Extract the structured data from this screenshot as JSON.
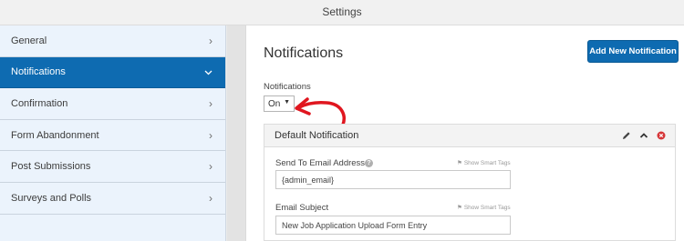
{
  "window": {
    "title": "Settings"
  },
  "sidebar": {
    "items": [
      {
        "label": "General",
        "chevron": "chevron-right-icon",
        "active": false
      },
      {
        "label": "Notifications",
        "chevron": "chevron-down-icon",
        "active": true
      },
      {
        "label": "Confirmation",
        "chevron": "chevron-right-icon",
        "active": false
      },
      {
        "label": "Form Abandonment",
        "chevron": "chevron-right-icon",
        "active": false
      },
      {
        "label": "Post Submissions",
        "chevron": "chevron-right-icon",
        "active": false
      },
      {
        "label": "Surveys and Polls",
        "chevron": "chevron-right-icon",
        "active": false
      }
    ]
  },
  "main": {
    "title": "Notifications",
    "add_button_label": "Add New Notification",
    "notifications_field": {
      "label": "Notifications",
      "value": "On"
    },
    "card": {
      "title": "Default Notification",
      "fields": [
        {
          "label": "Send To Email Address",
          "value": "{admin_email}",
          "smart_tags_label": "Show Smart Tags",
          "has_help": true
        },
        {
          "label": "Email Subject",
          "value": "New Job Application Upload Form Entry",
          "smart_tags_label": "Show Smart Tags",
          "has_help": false
        }
      ]
    }
  },
  "colors": {
    "accent": "#0e6bb1",
    "annotation": "#e0161f",
    "delete": "#d63638"
  }
}
